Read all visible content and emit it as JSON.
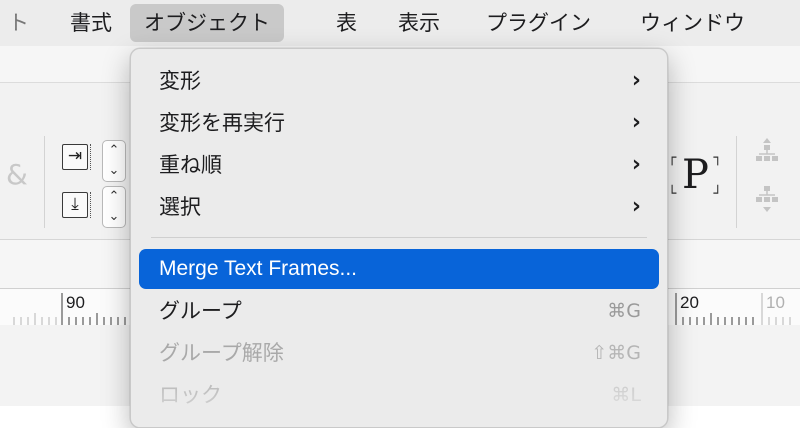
{
  "menubar": {
    "items": [
      {
        "label": "ト",
        "partial": true
      },
      {
        "label": "書式"
      },
      {
        "label": "オブジェクト",
        "active": true
      },
      {
        "label": "表"
      },
      {
        "label": "表示"
      },
      {
        "label": "プラグイン"
      },
      {
        "label": "ウィンドウ"
      }
    ]
  },
  "dropdown": {
    "items": [
      {
        "label": "変形",
        "submenu": true,
        "chevron": "›"
      },
      {
        "label": "変形を再実行",
        "submenu": true,
        "chevron": "›"
      },
      {
        "label": "重ね順",
        "submenu": true,
        "chevron": "›"
      },
      {
        "label": "選択",
        "submenu": true,
        "chevron": "›"
      },
      {
        "label": "Merge Text Frames...",
        "highlighted": true
      },
      {
        "label": "グループ",
        "shortcut": "⌘G"
      },
      {
        "label": "グループ解除",
        "shortcut": "⇧⌘G",
        "disabled": true
      },
      {
        "label": "ロック",
        "shortcut": "⌘L",
        "disabled": true,
        "partial": true
      }
    ]
  },
  "toolbar": {
    "ampersand": "&",
    "indent_right_glyph": "⇥",
    "indent_down_glyph": "⤓",
    "stepper_up": "⌃",
    "stepper_down": "⌄",
    "p_letter": "P",
    "bracket_tl": "┌",
    "bracket_br": "┘",
    "bracket_tr": "┐",
    "bracket_bl": "└"
  },
  "ruler": {
    "labels": [
      "90",
      "20",
      "10"
    ]
  },
  "colors": {
    "highlight": "#0864d9",
    "menubar_bg": "#ececec",
    "menu_bg": "#ebebeb"
  }
}
